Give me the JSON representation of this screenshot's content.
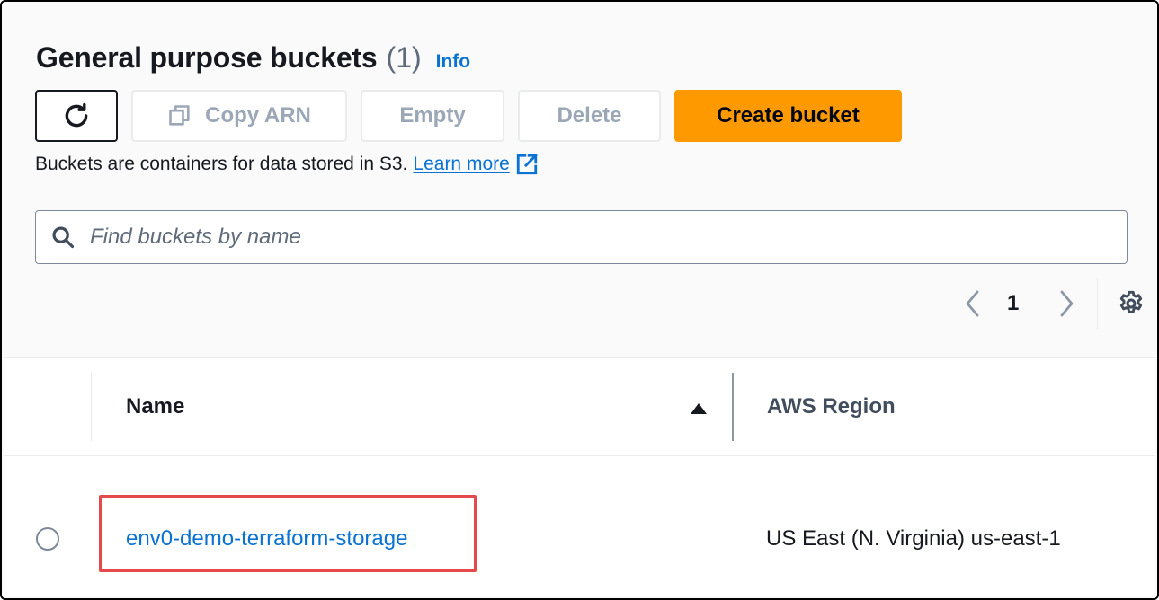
{
  "header": {
    "title": "General purpose buckets",
    "count": "(1)",
    "info_label": "Info"
  },
  "toolbar": {
    "copy_arn_label": "Copy ARN",
    "empty_label": "Empty",
    "delete_label": "Delete",
    "create_label": "Create bucket"
  },
  "description": {
    "text": "Buckets are containers for data stored in S3.",
    "link_label": "Learn more"
  },
  "search": {
    "placeholder": "Find buckets by name",
    "value": ""
  },
  "pagination": {
    "current_page": "1"
  },
  "table": {
    "columns": [
      "Name",
      "AWS Region"
    ],
    "rows": [
      {
        "name": "env0-demo-terraform-storage",
        "region": "US East (N. Virginia) us-east-1"
      }
    ]
  },
  "colors": {
    "accent": "#ff9900",
    "link": "#0972d3",
    "highlight": "#e5484d"
  },
  "icons": [
    "refresh-icon",
    "copy-icon",
    "external-link-icon",
    "search-icon",
    "chevron-left-icon",
    "chevron-right-icon",
    "settings-gear-icon",
    "sort-ascending-icon"
  ]
}
